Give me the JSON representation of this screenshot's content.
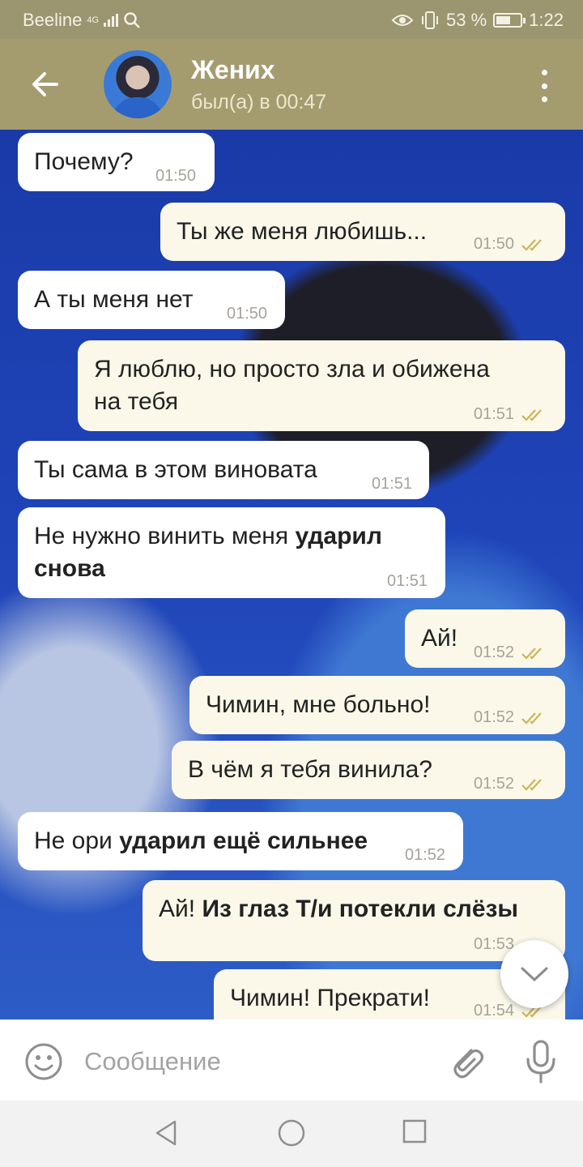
{
  "status_bar": {
    "carrier": "Beeline",
    "network": "4G",
    "battery": "53 %",
    "time": "1:22"
  },
  "header": {
    "title": "Жених",
    "subtitle": "был(а) в 00:47"
  },
  "messages": [
    {
      "dir": "in",
      "text": "Почему?",
      "time": "01:50"
    },
    {
      "dir": "out",
      "text": "Ты же меня любишь...",
      "time": "01:50",
      "read": true
    },
    {
      "dir": "in",
      "text": "А ты меня нет",
      "time": "01:50"
    },
    {
      "dir": "out",
      "line1": "Я люблю, но просто зла и обижена",
      "line2": "на тебя",
      "time": "01:51",
      "read": true
    },
    {
      "dir": "in",
      "text": "Ты сама в этом виновата",
      "time": "01:51"
    },
    {
      "dir": "in",
      "plain": "Не нужно винить меня ",
      "bold1": "ударил",
      "bold2": "снова",
      "time": "01:51"
    },
    {
      "dir": "out",
      "text": "Ай!",
      "time": "01:52",
      "read": true
    },
    {
      "dir": "out",
      "text": "Чимин, мне больно!",
      "time": "01:52",
      "read": true
    },
    {
      "dir": "out",
      "text": "В чём я тебя винила?",
      "time": "01:52",
      "read": true
    },
    {
      "dir": "in",
      "plain": "Не ори ",
      "bold": "ударил ещё сильнее",
      "time": "01:52"
    },
    {
      "dir": "out",
      "plain": "Ай! ",
      "bold": "Из глаз Т/и потекли слёзы",
      "time": "01:53"
    },
    {
      "dir": "out",
      "text": "Чимин! Прекрати!",
      "time": "01:54",
      "read": true
    }
  ],
  "input": {
    "placeholder": "Сообщение"
  },
  "colors": {
    "header": "#a49c6f",
    "status_bar": "#9b9570",
    "bubble_in": "#ffffff",
    "bubble_out": "#fbf8ea",
    "check": "#c9b65a"
  }
}
